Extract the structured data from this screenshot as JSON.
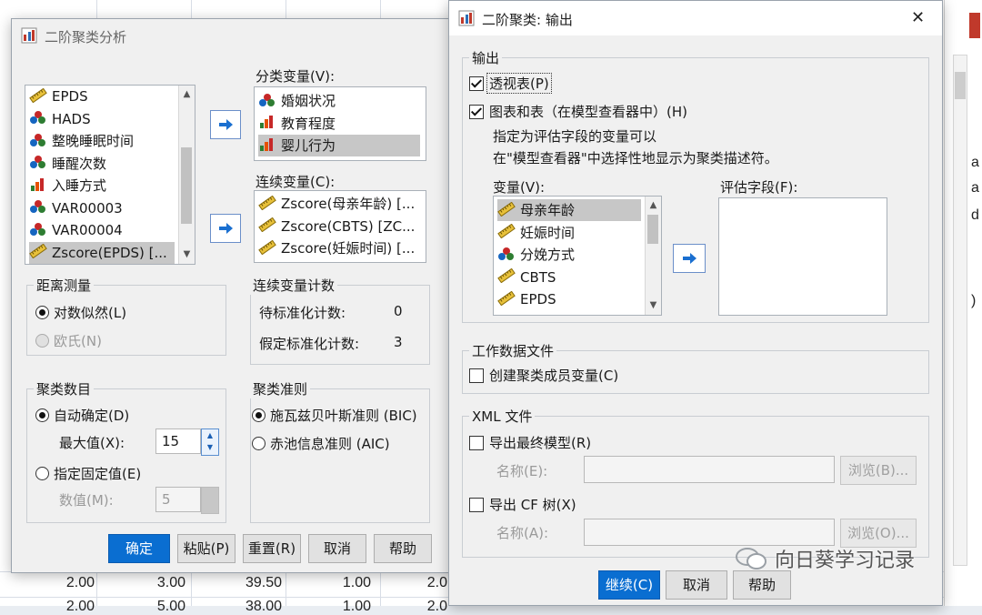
{
  "background_sheet": {
    "row1": [
      "2.00",
      "3.00",
      "39.50",
      "1.00",
      "2.0"
    ],
    "row2": [
      "2.00",
      "5.00",
      "38.00",
      "1.00",
      "2.0"
    ],
    "right_fragments": [
      "a",
      "a",
      "d",
      ")"
    ]
  },
  "main_dialog": {
    "title": "二阶聚类分析",
    "source_list": [
      {
        "label": "EPDS",
        "icon": "ruler-scale-icon"
      },
      {
        "label": "HADS",
        "icon": "nominal-icon"
      },
      {
        "label": "整晚睡眠时间",
        "icon": "nominal-icon"
      },
      {
        "label": "睡醒次数",
        "icon": "nominal-icon"
      },
      {
        "label": "入睡方式",
        "icon": "ordinal-bar-icon"
      },
      {
        "label": "VAR00003",
        "icon": "nominal-icon"
      },
      {
        "label": "VAR00004",
        "icon": "nominal-icon"
      },
      {
        "label": "Zscore(EPDS) [...",
        "icon": "ruler-scale-icon"
      }
    ],
    "categorical_label": "分类变量(V):",
    "categorical_list": [
      {
        "label": "婚姻状况",
        "icon": "nominal-icon"
      },
      {
        "label": "教育程度",
        "icon": "ordinal-bar-icon"
      },
      {
        "label": "婴儿行为",
        "icon": "ordinal-bar-icon"
      }
    ],
    "continuous_label": "连续变量(C):",
    "continuous_list": [
      {
        "label": "Zscore(母亲年龄) [...",
        "icon": "ruler-scale-icon"
      },
      {
        "label": "Zscore(CBTS) [ZC...",
        "icon": "ruler-scale-icon"
      },
      {
        "label": "Zscore(妊娠时间) [...",
        "icon": "ruler-scale-icon"
      }
    ],
    "distance_group": "距离测量",
    "distance_loglik": "对数似然(L)",
    "distance_euclid": "欧氏(N)",
    "contcount_group": "连续变量计数",
    "to_standardize_label": "待标准化计数:",
    "to_standardize_value": "0",
    "assumed_standardized_label": "假定标准化计数:",
    "assumed_standardized_value": "3",
    "clusters_group": "聚类数目",
    "auto_determine": "自动确定(D)",
    "max_label": "最大值(X):",
    "max_value": "15",
    "fixed_specify": "指定固定值(E)",
    "number_label": "数值(M):",
    "number_value": "5",
    "criterion_group": "聚类准则",
    "bic": "施瓦兹贝叶斯准则 (BIC)",
    "aic": "赤池信息准则 (AIC)",
    "buttons": {
      "ok": "确定",
      "paste": "粘贴(P)",
      "reset": "重置(R)",
      "cancel": "取消",
      "help": "帮助"
    }
  },
  "output_dialog": {
    "title": "二阶聚类: 输出",
    "close_glyph": "✕",
    "output_group": "输出",
    "pivot_tables": "透视表(P)",
    "charts_tables": "图表和表（在模型查看器中）(H)",
    "desc_line1": "指定为评估字段的变量可以",
    "desc_line2": "在\"模型查看器\"中选择性地显示为聚类描述符。",
    "variables_label": "变量(V):",
    "variables_list": [
      {
        "label": "母亲年龄",
        "icon": "ruler-scale-icon"
      },
      {
        "label": "妊娠时间",
        "icon": "ruler-scale-icon"
      },
      {
        "label": "分娩方式",
        "icon": "nominal-icon"
      },
      {
        "label": "CBTS",
        "icon": "ruler-scale-icon"
      },
      {
        "label": "EPDS",
        "icon": "ruler-scale-icon"
      }
    ],
    "eval_label": "评估字段(F):",
    "working_group": "工作数据文件",
    "create_cluster_var": "创建聚类成员变量(C)",
    "xml_group": "XML 文件",
    "export_final_model": "导出最终模型(R)",
    "name_label_1": "名称(E):",
    "browse_1": "浏览(B)...",
    "export_cf_tree": "导出 CF 树(X)",
    "name_label_2": "名称(A):",
    "browse_2": "浏览(O)...",
    "buttons": {
      "continue": "继续(C)",
      "cancel": "取消",
      "help": "帮助"
    }
  },
  "watermark": "向日葵学习记录",
  "colors": {
    "accent": "#0a6ed1",
    "selection": "#c7c7c7"
  }
}
